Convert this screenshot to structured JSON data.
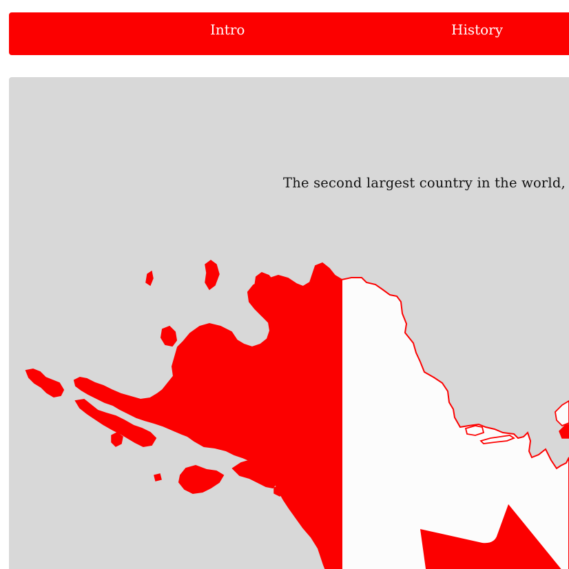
{
  "nav": {
    "items": [
      {
        "label": "Intro"
      },
      {
        "label": "History"
      }
    ],
    "background_color": "#fc0000",
    "text_color": "#ffffff"
  },
  "main": {
    "intro_text": "The second largest country in the world, t",
    "panel_color": "#d8d8d8",
    "map": {
      "depicts": "Flag-colored map of Alaska and Canada",
      "colors": {
        "fill_red": "#fc0000",
        "fill_white": "#fcfcfc",
        "outline": "#fc0000"
      }
    }
  }
}
